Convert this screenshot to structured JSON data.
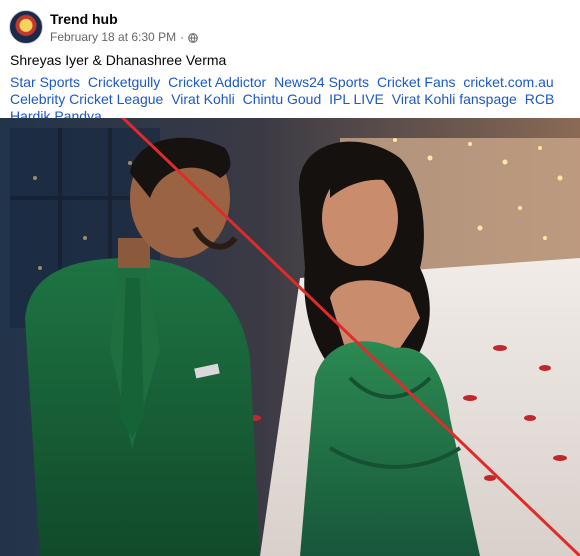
{
  "post": {
    "author": "Trend hub",
    "timestamp": "February 18 at 6:30 PM",
    "separator": "·",
    "privacy_icon": "globe-icon",
    "caption": "Shreyas Iyer & Dhanashree Verma",
    "tags": [
      "Star Sports",
      "Cricketgully",
      "Cricket Addictor",
      "News24 Sports",
      "Cricket Fans",
      "cricket.com.au",
      "Celebrity Cricket League",
      "Virat Kohli",
      "Chintu Goud",
      "IPL LIVE",
      "Virat Kohli fanspage",
      "RCB",
      "Hardik Pandya"
    ]
  },
  "photo": {
    "description_icon": "couple-photo",
    "strike_color": "#e02b2b",
    "suit_color": "#1d6a3e",
    "dress_color": "#237a47"
  }
}
